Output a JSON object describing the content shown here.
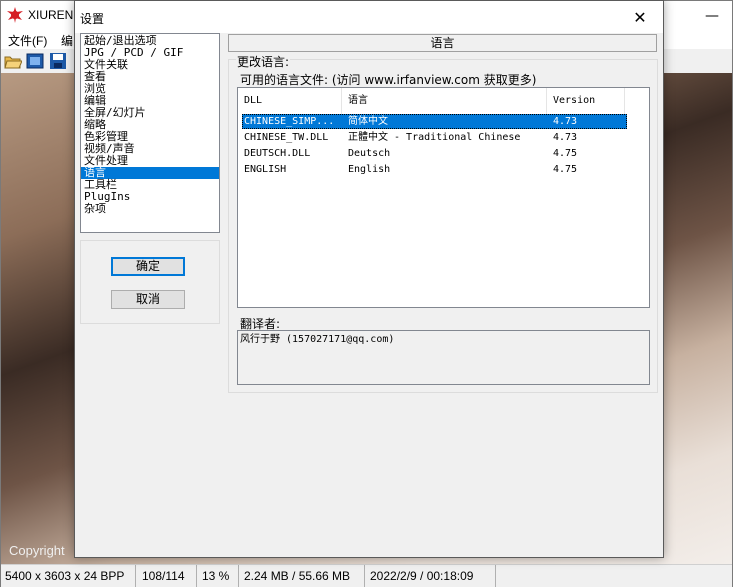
{
  "main_window": {
    "title": "XIUREN",
    "menu": [
      {
        "label": "文件(F)"
      },
      {
        "label": "编"
      }
    ],
    "minimize_glyph": "—",
    "close_glyph": "✕",
    "copyright_text": "Copyright",
    "status": {
      "dimensions": "5400 x 3603 x 24 BPP",
      "index": "108/114",
      "zoom": "13 %",
      "size": "2.24 MB / 55.66 MB",
      "datetime": "2022/2/9 / 00:18:09"
    }
  },
  "dialog": {
    "title": "设置",
    "close_glyph": "✕",
    "categories": [
      {
        "label": "起始/退出选项"
      },
      {
        "label": "JPG / PCD / GIF"
      },
      {
        "label": "文件关联"
      },
      {
        "label": "查看"
      },
      {
        "label": "浏览"
      },
      {
        "label": "编辑"
      },
      {
        "label": "全屏/幻灯片"
      },
      {
        "label": "缩略"
      },
      {
        "label": "色彩管理"
      },
      {
        "label": "视频/声音"
      },
      {
        "label": "文件处理"
      },
      {
        "label": "语言",
        "selected": true
      },
      {
        "label": "工具栏"
      },
      {
        "label": "PlugIns"
      },
      {
        "label": "杂项"
      }
    ],
    "ok_label": "确定",
    "cancel_label": "取消",
    "page_title": "语言",
    "change_lang_label": "更改语言:",
    "available_label": "可用的语言文件: (访问 www.irfanview.com 获取更多)",
    "table": {
      "columns": [
        "DLL",
        "语言",
        "Version"
      ],
      "rows": [
        {
          "dll": "CHINESE_SIMP...",
          "lang": "简体中文",
          "version": "4.73",
          "selected": true
        },
        {
          "dll": "CHINESE_TW.DLL",
          "lang": "正體中文 - Traditional Chinese",
          "version": "4.73"
        },
        {
          "dll": "DEUTSCH.DLL",
          "lang": "Deutsch",
          "version": "4.75"
        },
        {
          "dll": "ENGLISH",
          "lang": "English",
          "version": "4.75"
        }
      ]
    },
    "translator_label": "翻译者:",
    "translator_text": "风行于野 (157027171@qq.com)"
  },
  "colors": {
    "selection": "#0078d7",
    "dialog_bg": "#f0f0f0"
  }
}
